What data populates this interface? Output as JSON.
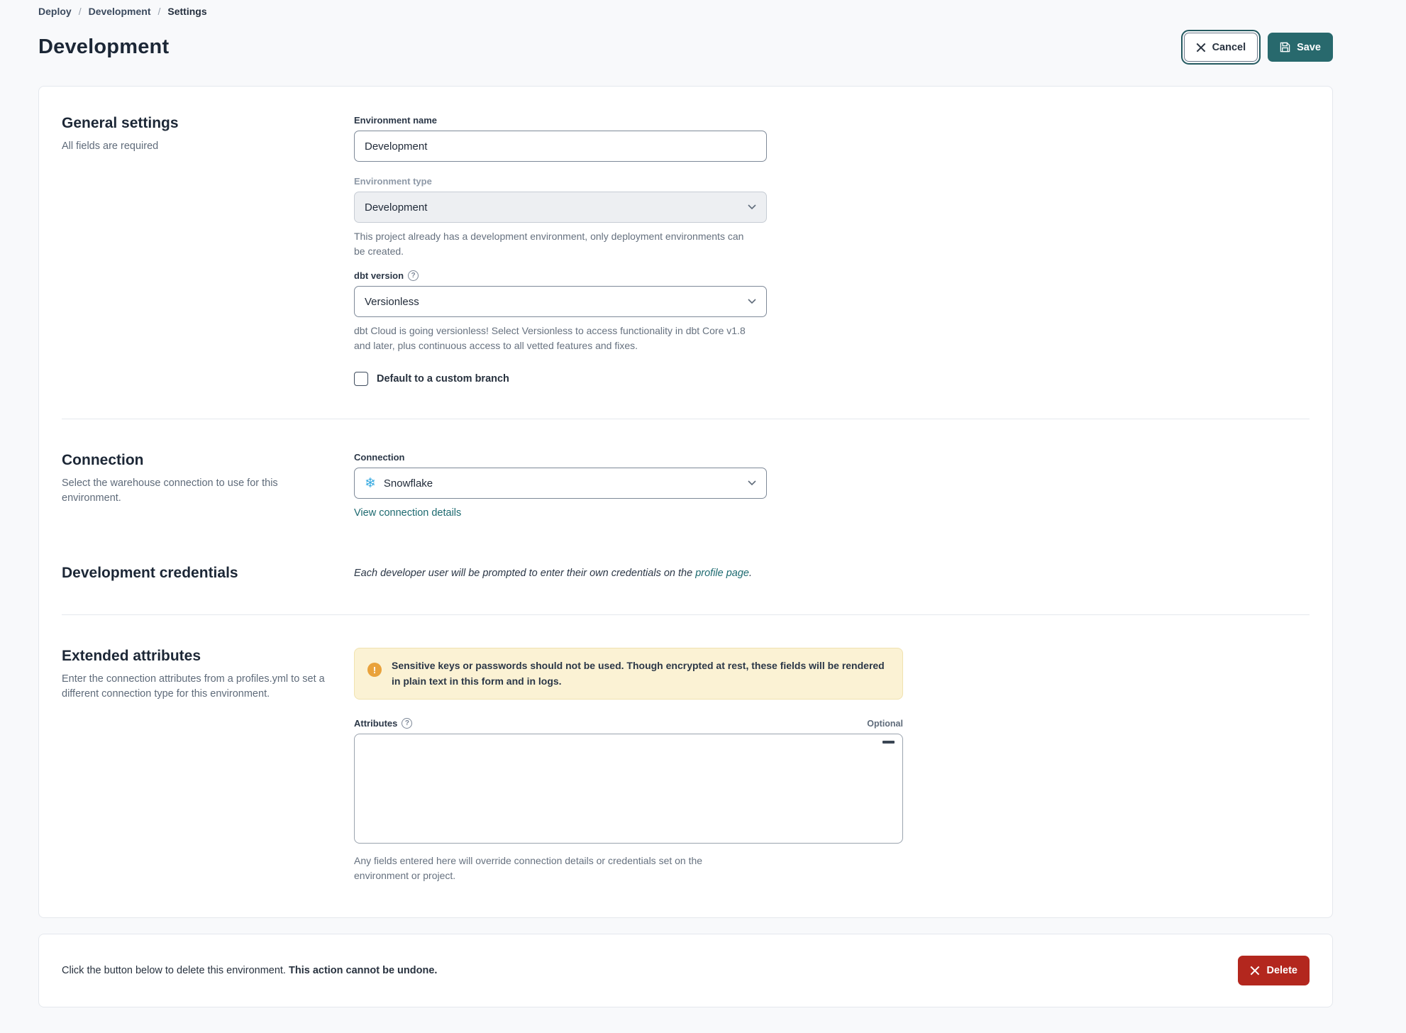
{
  "breadcrumb": {
    "items": [
      "Deploy",
      "Development",
      "Settings"
    ],
    "separator": "/"
  },
  "header": {
    "title": "Development",
    "cancel_label": "Cancel",
    "save_label": "Save"
  },
  "general": {
    "heading": "General settings",
    "subheading": "All fields are required",
    "env_name": {
      "label": "Environment name",
      "value": "Development"
    },
    "env_type": {
      "label": "Environment type",
      "value": "Development",
      "help": "This project already has a development environment, only deployment environments can be created."
    },
    "dbt_version": {
      "label": "dbt version",
      "value": "Versionless",
      "help": "dbt Cloud is going versionless! Select Versionless to access functionality in dbt Core v1.8 and later, plus continuous access to all vetted features and fixes."
    },
    "custom_branch": {
      "label": "Default to a custom branch",
      "checked": false
    }
  },
  "connection": {
    "heading": "Connection",
    "subheading": "Select the warehouse connection to use for this environment.",
    "field_label": "Connection",
    "value": "Snowflake",
    "snowflake_icon_glyph": "❄",
    "link": "View connection details"
  },
  "credentials": {
    "heading": "Development credentials",
    "note_prefix": "Each developer user will be prompted to enter their own credentials on the ",
    "note_link": "profile page",
    "note_suffix": "."
  },
  "extended": {
    "heading": "Extended attributes",
    "subheading": "Enter the connection attributes from a profiles.yml to set a different connection type for this environment.",
    "warning": "Sensitive keys or passwords should not be used. Though encrypted at rest, these fields will be rendered in plain text in this form and in logs.",
    "warning_icon_glyph": "!",
    "attributes_label": "Attributes",
    "optional_label": "Optional",
    "textarea_value": "",
    "helper": "Any fields entered here will override connection details or credentials set on the environment or project."
  },
  "danger": {
    "text_prefix": "Click the button below to delete this environment. ",
    "text_bold": "This action cannot be undone.",
    "delete_label": "Delete"
  },
  "colors": {
    "accent_teal": "#28696D",
    "link_teal": "#1D6A70",
    "danger_red": "#B3271E",
    "warning_bg": "#FBF2D4",
    "warning_icon": "#E9A23B",
    "snowflake_blue": "#35A9E0"
  }
}
